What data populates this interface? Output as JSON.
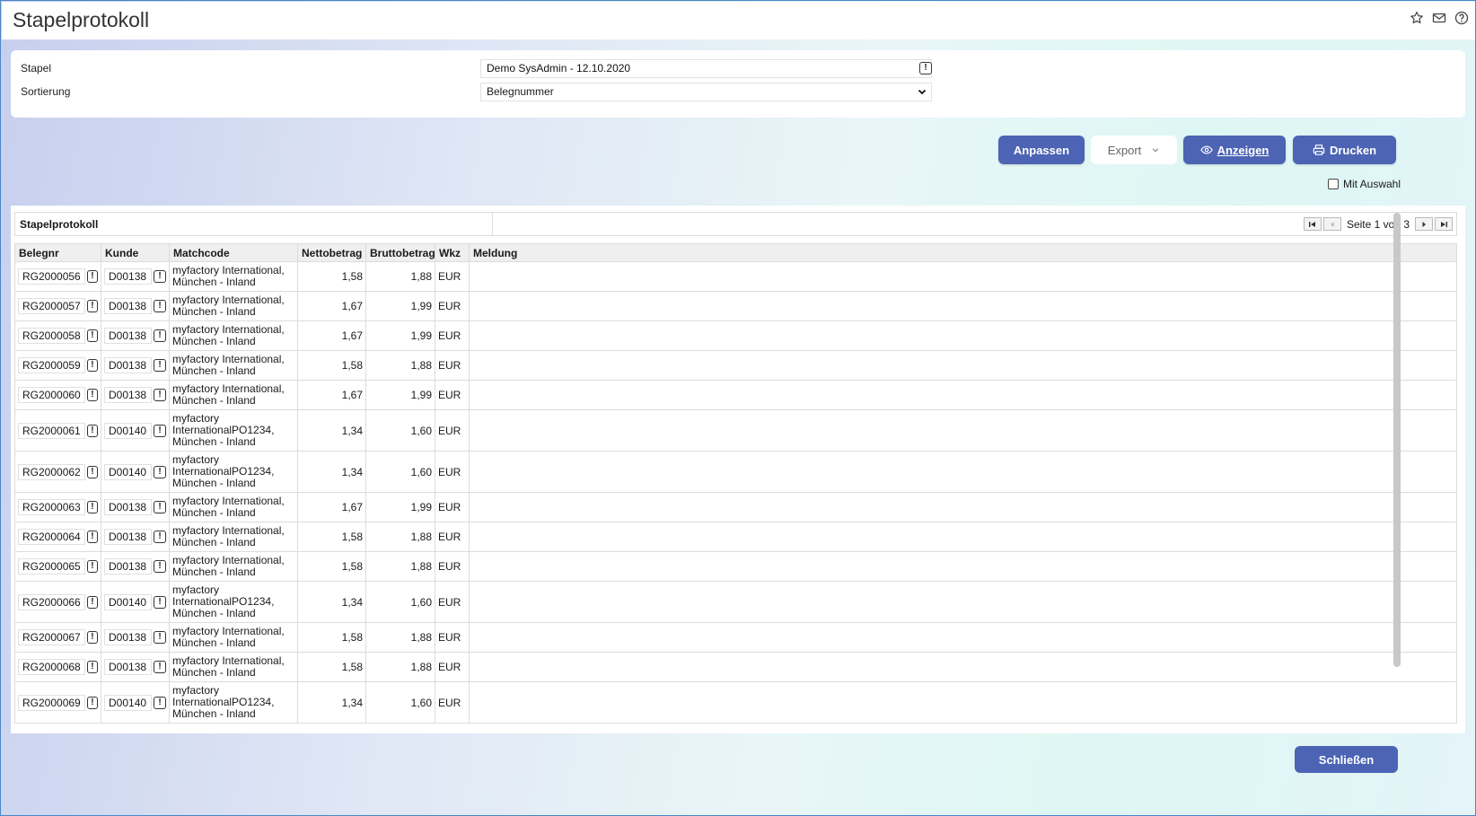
{
  "window": {
    "title": "Stapelprotokoll"
  },
  "titlebar_icons": [
    "star-icon",
    "mail-icon",
    "help-icon"
  ],
  "form": {
    "stapel_label": "Stapel",
    "stapel_value": "Demo SysAdmin - 12.10.2020",
    "sortierung_label": "Sortierung",
    "sortierung_value": "Belegnummer"
  },
  "toolbar": {
    "anpassen": "Anpassen",
    "export": "Export",
    "anzeigen": "Anzeigen",
    "drucken": "Drucken",
    "mit_auswahl": "Mit Auswahl"
  },
  "grid": {
    "title": "Stapelprotokoll",
    "pager_text": "Seite 1 von 3",
    "columns": [
      "Belegnr",
      "Kunde",
      "Matchcode",
      "Nettobetrag",
      "Bruttobetrag",
      "Wkz",
      "Meldung"
    ],
    "rows": [
      {
        "belegnr": "RG2000056",
        "kunde": "D00138",
        "matchcode": "myfactory International, München - Inland",
        "netto": "1,58",
        "brutto": "1,88",
        "wkz": "EUR",
        "meldung": ""
      },
      {
        "belegnr": "RG2000057",
        "kunde": "D00138",
        "matchcode": "myfactory International, München - Inland",
        "netto": "1,67",
        "brutto": "1,99",
        "wkz": "EUR",
        "meldung": ""
      },
      {
        "belegnr": "RG2000058",
        "kunde": "D00138",
        "matchcode": "myfactory International, München - Inland",
        "netto": "1,67",
        "brutto": "1,99",
        "wkz": "EUR",
        "meldung": ""
      },
      {
        "belegnr": "RG2000059",
        "kunde": "D00138",
        "matchcode": "myfactory International, München - Inland",
        "netto": "1,58",
        "brutto": "1,88",
        "wkz": "EUR",
        "meldung": ""
      },
      {
        "belegnr": "RG2000060",
        "kunde": "D00138",
        "matchcode": "myfactory International, München - Inland",
        "netto": "1,67",
        "brutto": "1,99",
        "wkz": "EUR",
        "meldung": ""
      },
      {
        "belegnr": "RG2000061",
        "kunde": "D00140",
        "matchcode": "myfactory InternationalPO1234, München - Inland",
        "netto": "1,34",
        "brutto": "1,60",
        "wkz": "EUR",
        "meldung": ""
      },
      {
        "belegnr": "RG2000062",
        "kunde": "D00140",
        "matchcode": "myfactory InternationalPO1234, München - Inland",
        "netto": "1,34",
        "brutto": "1,60",
        "wkz": "EUR",
        "meldung": ""
      },
      {
        "belegnr": "RG2000063",
        "kunde": "D00138",
        "matchcode": "myfactory International, München - Inland",
        "netto": "1,67",
        "brutto": "1,99",
        "wkz": "EUR",
        "meldung": ""
      },
      {
        "belegnr": "RG2000064",
        "kunde": "D00138",
        "matchcode": "myfactory International, München - Inland",
        "netto": "1,58",
        "brutto": "1,88",
        "wkz": "EUR",
        "meldung": ""
      },
      {
        "belegnr": "RG2000065",
        "kunde": "D00138",
        "matchcode": "myfactory International, München - Inland",
        "netto": "1,58",
        "brutto": "1,88",
        "wkz": "EUR",
        "meldung": ""
      },
      {
        "belegnr": "RG2000066",
        "kunde": "D00140",
        "matchcode": "myfactory InternationalPO1234, München - Inland",
        "netto": "1,34",
        "brutto": "1,60",
        "wkz": "EUR",
        "meldung": ""
      },
      {
        "belegnr": "RG2000067",
        "kunde": "D00138",
        "matchcode": "myfactory International, München - Inland",
        "netto": "1,58",
        "brutto": "1,88",
        "wkz": "EUR",
        "meldung": ""
      },
      {
        "belegnr": "RG2000068",
        "kunde": "D00138",
        "matchcode": "myfactory International, München - Inland",
        "netto": "1,58",
        "brutto": "1,88",
        "wkz": "EUR",
        "meldung": ""
      },
      {
        "belegnr": "RG2000069",
        "kunde": "D00140",
        "matchcode": "myfactory InternationalPO1234, München - Inland",
        "netto": "1,34",
        "brutto": "1,60",
        "wkz": "EUR",
        "meldung": ""
      }
    ]
  },
  "footer": {
    "close": "Schließen"
  },
  "colors": {
    "primary_button": "#4c64b3",
    "frame_border": "#4a86c8"
  }
}
